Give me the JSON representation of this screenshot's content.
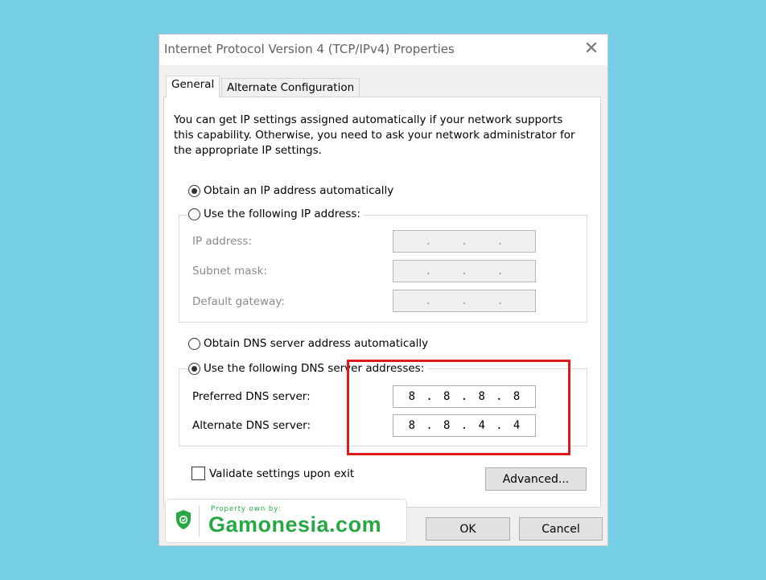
{
  "dialog": {
    "title": "Internet Protocol Version 4 (TCP/IPv4) Properties",
    "close_glyph": "✕"
  },
  "tabs": [
    {
      "label": "General",
      "active": true
    },
    {
      "label": "Alternate Configuration",
      "active": false
    }
  ],
  "description": "You can get IP settings assigned automatically if your network supports this capability. Otherwise, you need to ask your network administrator for the appropriate IP settings.",
  "ip": {
    "auto_label": "Obtain an IP address automatically",
    "auto_selected": true,
    "manual_label": "Use the following IP address:",
    "manual_selected": false,
    "fields": [
      {
        "label": "IP address:",
        "octets": [
          "",
          "",
          "",
          ""
        ]
      },
      {
        "label": "Subnet mask:",
        "octets": [
          "",
          "",
          "",
          ""
        ]
      },
      {
        "label": "Default gateway:",
        "octets": [
          "",
          "",
          "",
          ""
        ]
      }
    ]
  },
  "dns": {
    "auto_label": "Obtain DNS server address automatically",
    "auto_selected": false,
    "manual_label": "Use the following DNS server addresses:",
    "manual_selected": true,
    "preferred_label": "Preferred DNS server:",
    "preferred_octets": [
      "8",
      "8",
      "8",
      "8"
    ],
    "alternate_label": "Alternate DNS server:",
    "alternate_octets": [
      "8",
      "8",
      "4",
      "4"
    ]
  },
  "validate": {
    "label": "Validate settings upon exit",
    "checked": false
  },
  "buttons": {
    "advanced": "Advanced...",
    "ok": "OK",
    "cancel": "Cancel"
  },
  "watermark": {
    "small": "Property own by:",
    "brand": "Gamonesia.com",
    "color": "#27a844"
  },
  "colors": {
    "background": "#75cde6",
    "highlight": "#e01b1b"
  }
}
